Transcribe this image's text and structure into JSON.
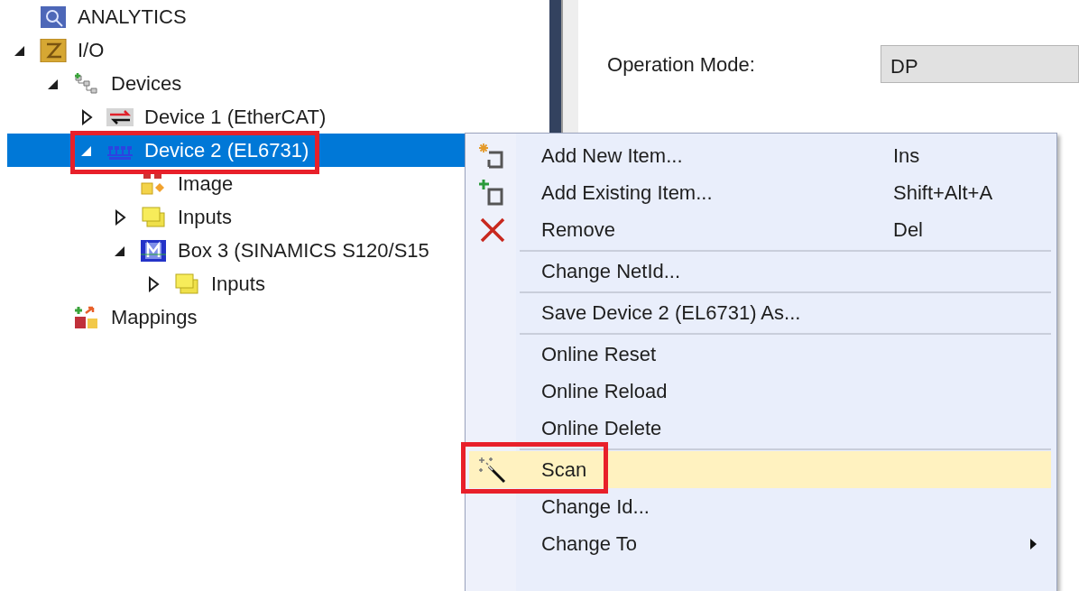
{
  "tree": {
    "items": [
      {
        "label": "ANALYTICS",
        "kind": "analytics",
        "selected": false
      },
      {
        "label": "I/O",
        "kind": "io",
        "expanded": true,
        "selected": false,
        "children": [
          {
            "label": "Devices",
            "kind": "devices",
            "expanded": true,
            "selected": false,
            "children": [
              {
                "label": "Device 1 (EtherCAT)",
                "kind": "ethercat",
                "expanded": false,
                "selected": false
              },
              {
                "label": "Device 2 (EL6731)",
                "kind": "fieldbus",
                "expanded": true,
                "selected": true,
                "annotated": true,
                "children": [
                  {
                    "label": "Image",
                    "kind": "image",
                    "selected": false
                  },
                  {
                    "label": "Inputs",
                    "kind": "inputs",
                    "expanded": false,
                    "selected": false
                  },
                  {
                    "label": "Box 3 (SINAMICS S120/S15",
                    "kind": "box",
                    "expanded": true,
                    "selected": false,
                    "children": [
                      {
                        "label": "Inputs",
                        "kind": "inputs",
                        "expanded": false,
                        "selected": false
                      }
                    ]
                  }
                ]
              }
            ]
          },
          {
            "label": "Mappings",
            "kind": "mappings",
            "selected": false
          }
        ]
      }
    ]
  },
  "properties": {
    "fields": [
      {
        "label": "Operation Mode:",
        "value": "DP"
      }
    ]
  },
  "context_menu": {
    "items": [
      {
        "kind": "item",
        "label": "Add New Item...",
        "shortcut": "Ins",
        "selected": false
      },
      {
        "kind": "item",
        "label": "Add Existing Item...",
        "shortcut": "Shift+Alt+A",
        "selected": false
      },
      {
        "kind": "item",
        "label": "Remove",
        "shortcut": "Del",
        "selected": false
      },
      {
        "kind": "separator"
      },
      {
        "kind": "item",
        "label": "Change NetId...",
        "selected": false
      },
      {
        "kind": "separator"
      },
      {
        "kind": "item",
        "label": "Save Device 2 (EL6731) As...",
        "selected": false
      },
      {
        "kind": "separator"
      },
      {
        "kind": "item",
        "label": "Online Reset",
        "selected": false
      },
      {
        "kind": "item",
        "label": "Online Reload",
        "selected": false
      },
      {
        "kind": "item",
        "label": "Online Delete",
        "selected": false
      },
      {
        "kind": "separator"
      },
      {
        "kind": "item",
        "label": "Scan",
        "selected": true,
        "annotated": true
      },
      {
        "kind": "item",
        "label": "Change Id...",
        "selected": false
      },
      {
        "kind": "item",
        "label": "Change To",
        "submenu": true,
        "selected": false
      }
    ]
  }
}
